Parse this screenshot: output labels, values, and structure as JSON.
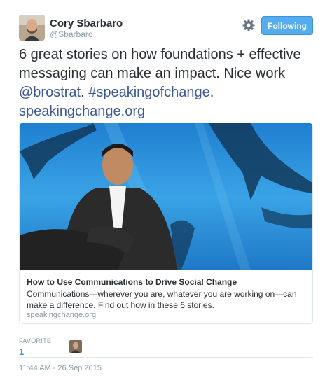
{
  "author": {
    "name": "Cory Sbarbaro",
    "handle": "@Sbarbaro"
  },
  "follow_button": {
    "label": "Following"
  },
  "tweet": {
    "text_part1": "6 great stories on how foundations + effective messaging can make an impact. Nice work ",
    "mention": "@brostrat",
    "text_part2": ". ",
    "hashtag": "#speakingofchange",
    "text_part3": ".",
    "link": "speakingchange.org"
  },
  "card": {
    "title": "How to Use Communications to Drive Social Change",
    "description": "Communications—wherever you are, whatever you are working on—can make a difference. Find out how in these 6 stories.",
    "domain": "speakingchange.org"
  },
  "stats": {
    "favorite_label": "FAVORITE",
    "favorite_count": "1"
  },
  "timestamp": "11:44 AM - 26 Sep 2015",
  "colors": {
    "accent": "#55acee",
    "link": "#3b5998",
    "muted": "#8899a6",
    "text": "#292f33"
  }
}
